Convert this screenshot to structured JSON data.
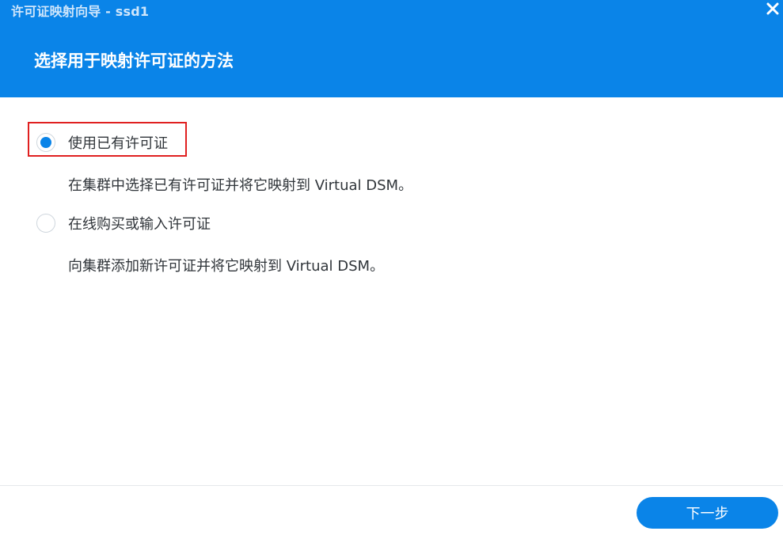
{
  "window": {
    "title": "许可证映射向导 - ssd1",
    "close_icon": "close-icon"
  },
  "header": {
    "heading": "选择用于映射许可证的方法"
  },
  "options": [
    {
      "label": "使用已有许可证",
      "description": "在集群中选择已有许可证并将它映射到 Virtual DSM。",
      "selected": true
    },
    {
      "label": "在线购买或输入许可证",
      "description": "向集群添加新许可证并将它映射到 Virtual DSM。",
      "selected": false
    }
  ],
  "footer": {
    "next_label": "下一步"
  },
  "colors": {
    "accent": "#0a84e8",
    "highlight": "#e02020"
  }
}
